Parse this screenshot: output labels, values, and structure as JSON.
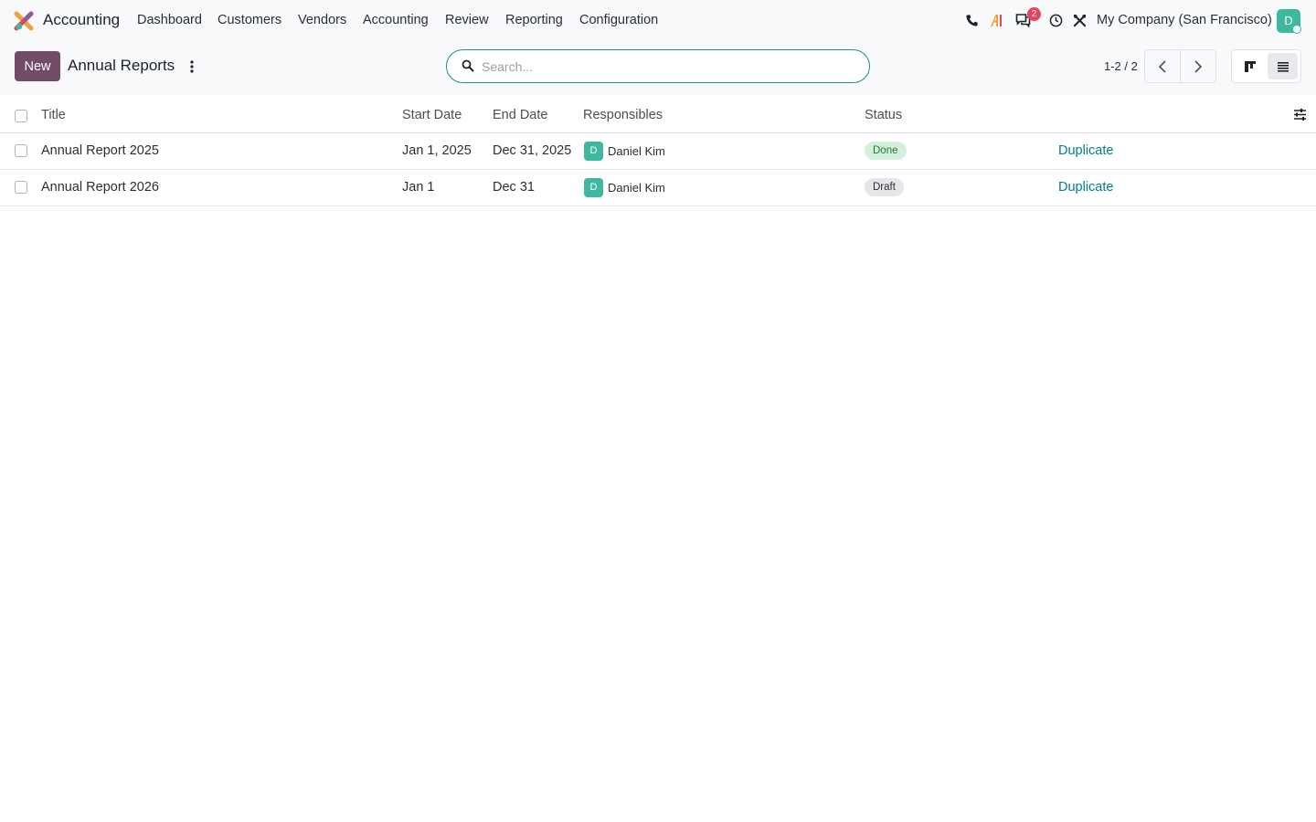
{
  "navbar": {
    "app_name": "Accounting",
    "menus": [
      "Dashboard",
      "Customers",
      "Vendors",
      "Accounting",
      "Review",
      "Reporting",
      "Configuration"
    ],
    "message_badge": "2",
    "company": "My Company (San Francisco)",
    "user_initial": "D",
    "icons": [
      "phone-icon",
      "ai-icon",
      "messages-icon",
      "activity-clock-icon",
      "tools-icon"
    ]
  },
  "control": {
    "new_label": "New",
    "title": "Annual Reports",
    "search_placeholder": "Search...",
    "pager": "1-2 / 2"
  },
  "table": {
    "columns": {
      "title": "Title",
      "start_date": "Start Date",
      "end_date": "End Date",
      "responsibles": "Responsibles",
      "status": "Status"
    },
    "rows": [
      {
        "title": "Annual Report 2025",
        "start_date": "Jan 1, 2025",
        "end_date": "Dec 31, 2025",
        "responsible_initial": "D",
        "responsible": "Daniel Kim",
        "status": "Done",
        "action": "Duplicate"
      },
      {
        "title": "Annual Report 2026",
        "start_date": "Jan 1",
        "end_date": "Dec 31",
        "responsible_initial": "D",
        "responsible": "Daniel Kim",
        "status": "Draft",
        "action": "Duplicate"
      }
    ]
  },
  "colors": {
    "brand": "#714b67",
    "accent": "#017e84",
    "avatar": "#3fb8a0",
    "badge": "#e4475c",
    "status_done_bg": "#d4f0dd",
    "status_draft_bg": "#e4e6e9"
  }
}
